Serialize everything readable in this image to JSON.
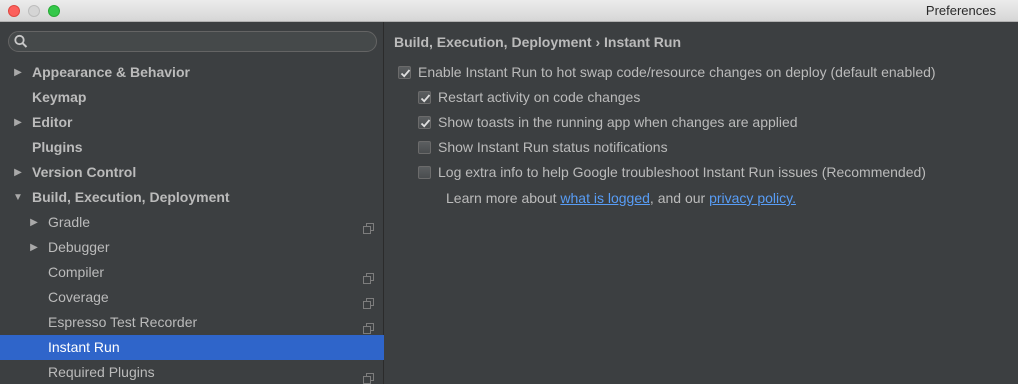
{
  "window": {
    "title": "Preferences"
  },
  "search": {
    "placeholder": "",
    "value": ""
  },
  "tree": [
    {
      "label": "Appearance & Behavior",
      "level": 0,
      "arrow": "right",
      "copy": false,
      "selected": false
    },
    {
      "label": "Keymap",
      "level": 0,
      "arrow": "",
      "copy": false,
      "selected": false
    },
    {
      "label": "Editor",
      "level": 0,
      "arrow": "right",
      "copy": false,
      "selected": false
    },
    {
      "label": "Plugins",
      "level": 0,
      "arrow": "",
      "copy": false,
      "selected": false
    },
    {
      "label": "Version Control",
      "level": 0,
      "arrow": "right",
      "copy": false,
      "selected": false
    },
    {
      "label": "Build, Execution, Deployment",
      "level": 0,
      "arrow": "down",
      "copy": false,
      "selected": false
    },
    {
      "label": "Gradle",
      "level": 1,
      "arrow": "right",
      "copy": true,
      "selected": false
    },
    {
      "label": "Debugger",
      "level": 1,
      "arrow": "right",
      "copy": false,
      "selected": false
    },
    {
      "label": "Compiler",
      "level": 1,
      "arrow": "",
      "copy": true,
      "selected": false
    },
    {
      "label": "Coverage",
      "level": 1,
      "arrow": "",
      "copy": true,
      "selected": false
    },
    {
      "label": "Espresso Test Recorder",
      "level": 1,
      "arrow": "",
      "copy": true,
      "selected": false
    },
    {
      "label": "Instant Run",
      "level": 1,
      "arrow": "",
      "copy": false,
      "selected": true
    },
    {
      "label": "Required Plugins",
      "level": 1,
      "arrow": "",
      "copy": true,
      "selected": false
    }
  ],
  "main": {
    "breadcrumb": "Build, Execution, Deployment › Instant Run",
    "options": [
      {
        "label": "Enable Instant Run to hot swap code/resource changes on deploy (default enabled)",
        "checked": true
      },
      {
        "label": "Restart activity on code changes",
        "checked": true
      },
      {
        "label": "Show toasts in the running app when changes are applied",
        "checked": true
      },
      {
        "label": "Show Instant Run status notifications",
        "checked": false
      },
      {
        "label": "Log extra info to help Google troubleshoot Instant Run issues (Recommended)",
        "checked": false
      }
    ],
    "learn_more": {
      "prefix": "Learn more about ",
      "link1": "what is logged",
      "middle": ", and our ",
      "link2": "privacy policy."
    }
  },
  "colors": {
    "selection": "#2f65ca",
    "link": "#589df6",
    "background": "#3c3f41"
  }
}
